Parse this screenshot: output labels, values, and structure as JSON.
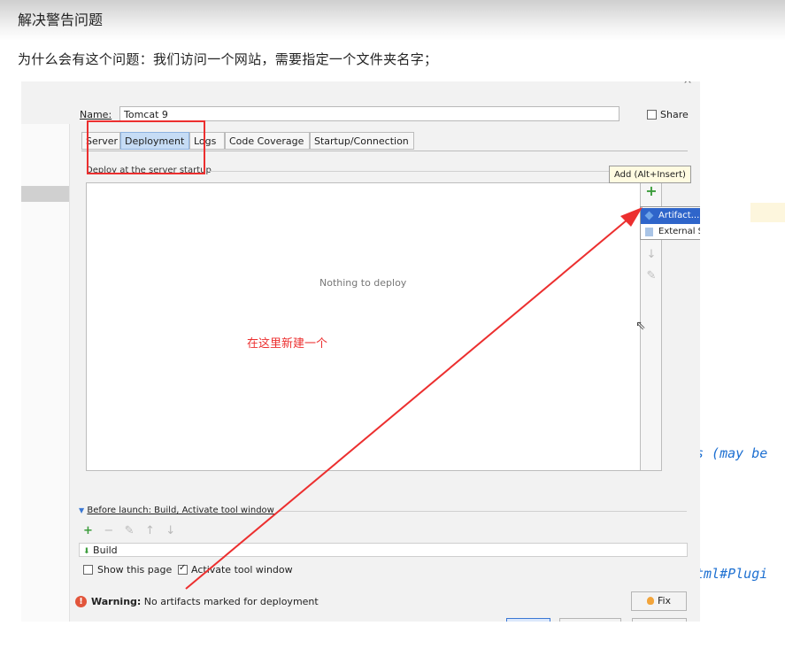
{
  "heading": "解决警告问题",
  "question": "为什么会有这个问题：我们访问一个网站，需要指定一个文件夹名字；",
  "dialog": {
    "name_label": "Name:",
    "name_value": "Tomcat 9",
    "share_label": "Share",
    "tabs": [
      "Server",
      "Deployment",
      "Logs",
      "Code Coverage",
      "Startup/Connection"
    ],
    "active_tab": "Deployment",
    "deploy_group_label": "Deploy at the server startup",
    "empty_text": "Nothing to deploy",
    "tooltip": "Add (Alt+Insert)",
    "add_menu": [
      "Artifact...",
      "External Source..."
    ],
    "before_launch_label": "Before launch: Build, Activate tool window",
    "build_item": "Build",
    "show_page_label": "Show this page",
    "activate_label": "Activate tool window",
    "warning_bold": "Warning:",
    "warning_text": "No artifacts marked for deployment",
    "fix_label": "Fix"
  },
  "annotation": "在这里新建一个",
  "background_code": [
    "s (may be",
    "tml#Plugi"
  ],
  "colors": {
    "annotation_red": "#ec2f2f",
    "menu_selected": "#2f65ca",
    "code_blue": "#1c6fd1"
  }
}
